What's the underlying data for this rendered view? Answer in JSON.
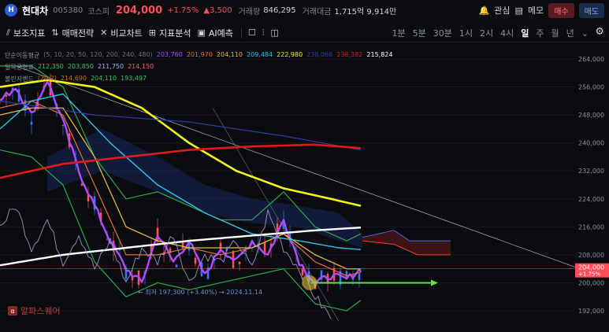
{
  "header": {
    "logo_icon": "hyundai-logo-icon",
    "name": "현대차",
    "code": "005380",
    "market": "코스피",
    "price": "204,000",
    "change_pct": "+1.75%",
    "change_amt": "▲3,500",
    "volume_label": "거래량",
    "volume": "846,295",
    "amount_label": "거래대금",
    "amount": "1,715억 9,914만",
    "watch_label": "관심",
    "memo_label": "메모",
    "buy_label": "매수",
    "sell_label": "매도"
  },
  "toolbar": {
    "items": [
      {
        "icon": "indicator-icon",
        "label": "보조지표"
      },
      {
        "icon": "strategy-icon",
        "label": "매매전략"
      },
      {
        "icon": "compare-icon",
        "label": "비교차트"
      },
      {
        "icon": "analysis-icon",
        "label": "지표분석"
      },
      {
        "icon": "ai-icon",
        "label": "AI예측"
      }
    ],
    "timeframes": [
      "1분",
      "5분",
      "30분",
      "1시",
      "2시",
      "4시",
      "일",
      "주",
      "월",
      "년"
    ],
    "active_timeframe": "일"
  },
  "legends": {
    "ma": {
      "label": "단순이동평균",
      "params": "(5, 10, 20, 50, 120, 200, 240, 480)",
      "values": [
        {
          "v": "203,760",
          "c": "#b04bff"
        },
        {
          "v": "201,970",
          "c": "#e0703a"
        },
        {
          "v": "204,110",
          "c": "#e6b84a"
        },
        {
          "v": "209,484",
          "c": "#29c6e6"
        },
        {
          "v": "222,980",
          "c": "#f2f21c"
        },
        {
          "v": "238,066",
          "c": "#2e3ea8"
        },
        {
          "v": "236,382",
          "c": "#e01b1b"
        },
        {
          "v": "215,824",
          "c": "#ffffff"
        }
      ]
    },
    "ichimoku": {
      "label": "일목균형표",
      "values": [
        {
          "v": "212,350",
          "c": "#3cc25a"
        },
        {
          "v": "203,850",
          "c": "#3cc25a"
        },
        {
          "v": "211,750",
          "c": "#9fb0ff"
        },
        {
          "v": "214,150",
          "c": "#ff5a5a"
        }
      ]
    },
    "bollinger": {
      "label": "볼린저밴드",
      "values": [
        {
          "v": "(20,2)",
          "c": "#cc6a2a"
        },
        {
          "v": "214,690",
          "c": "#cc6a2a"
        },
        {
          "v": "204,110",
          "c": "#3cc25a"
        },
        {
          "v": "193,497",
          "c": "#3cc25a"
        }
      ]
    }
  },
  "yaxis": {
    "ticks": [
      "264,000",
      "256,000",
      "248,000",
      "240,000",
      "232,000",
      "224,000",
      "216,000",
      "208,000",
      "200,000",
      "192,000"
    ]
  },
  "current_price_tag": {
    "price": "204,000",
    "pct": "+1.75%"
  },
  "low_annotation": "← 최저 197,300 (+3.40%) → 2024.11.14",
  "watermark": {
    "icon": "alpha-square-icon",
    "text": "알파스퀘어"
  },
  "colors": {
    "up": "#ff4d5a",
    "down": "#2f7bff",
    "bg": "#0b0c0f"
  }
}
